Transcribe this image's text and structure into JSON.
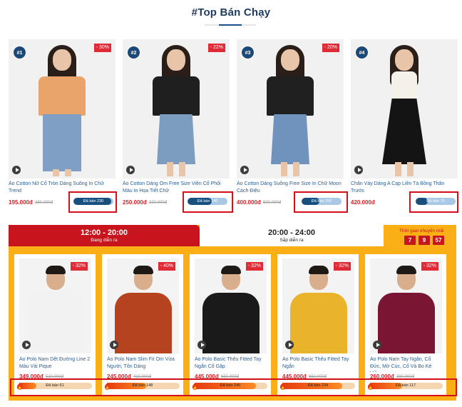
{
  "section_title": "#Top Bán Chạy",
  "top_products": [
    {
      "rank": "#1",
      "discount": "- 30%",
      "name": "Áo Cotton Nữ Cổ Tròn Dáng Suông In Chữ Trend",
      "price": "195.000đ",
      "old_price": "280.000đ",
      "sold": "Đã bán 230",
      "sold_fraction": 0.95,
      "top_color": "#e8a46a",
      "bottom_color": "#7f9fc5"
    },
    {
      "rank": "#2",
      "discount": "- 22%",
      "name": "Áo Cotton Dáng Ôm Free Size Viền Cổ Phối Màu In Họa Tiết Chữ",
      "price": "250.000đ",
      "old_price": "320.000đ",
      "sold": "Đã bán 140",
      "sold_fraction": 0.6,
      "top_color": "#1f1f1f",
      "bottom_color": "#7c9cc0"
    },
    {
      "rank": "#3",
      "discount": "- 20%",
      "name": "Áo Cotton Dáng Suông Free Size In Chữ Moon Cách Điệu",
      "price": "400.000đ",
      "old_price": "500.000đ",
      "sold": "Đã bán 100",
      "sold_fraction": 0.45,
      "top_color": "#202020",
      "bottom_color": "#6f93bd"
    },
    {
      "rank": "#4",
      "discount": "",
      "name": "Chân Váy Dáng A Cạp Liền Tà Bồng Thân Trước",
      "price": "420.000đ",
      "old_price": "",
      "sold": "Đã bán 70",
      "sold_fraction": 0.3,
      "top_color": "#f4f1ea",
      "bottom_color": "#141414"
    }
  ],
  "flash_sale": {
    "tabs": [
      {
        "time": "12:00 - 20:00",
        "status": "Đang diễn ra"
      },
      {
        "time": "20:00 - 24:00",
        "status": "Sắp diễn ra"
      }
    ],
    "countdown_label": "Thời gian khuyến mãi",
    "countdown": [
      "7",
      "9",
      "57"
    ],
    "products": [
      {
        "discount": "- 32%",
        "name": "Áo Polo Nam Dệt Đường Line 2 Màu Vải Pique",
        "price": "349.000đ",
        "old_price": "510.000đ",
        "sold": "Đã bán 61",
        "sold_fraction": 0.25,
        "shirt_color": "#f2f2f2"
      },
      {
        "discount": "- 40%",
        "name": "Áo Polo Nam Slim Fit Ôm Vừa Người, Tôn Dáng",
        "price": "245.000đ",
        "old_price": "410.000đ",
        "sold": "Đã bán 148",
        "sold_fraction": 0.55,
        "shirt_color": "#b5431f"
      },
      {
        "discount": "- 32%",
        "name": "Áo Polo Basic Thêu Fitted Tay Ngắn Cổ Gập",
        "price": "445.000đ",
        "old_price": "650.000đ",
        "sold": "Đã bán 240",
        "sold_fraction": 0.85,
        "shirt_color": "#1a1a1a"
      },
      {
        "discount": "- 32%",
        "name": "Áo Polo Basic Thêu Fitted Tay Ngắn",
        "price": "445.000đ",
        "old_price": "650.000đ",
        "sold": "Đã bán 234",
        "sold_fraction": 0.83,
        "shirt_color": "#e9b42c"
      },
      {
        "discount": "- 32%",
        "name": "Áo Polo Nam Tay Ngắn, Cổ Đức, Mờ Cúc, Cổ Và Bo Kẻ Viền",
        "price": "260.000đ",
        "old_price": "380.000đ",
        "sold": "Đã bán 117",
        "sold_fraction": 0.45,
        "shirt_color": "#7a1634"
      }
    ]
  },
  "colors": {
    "brand_blue": "#1c4a78",
    "sale_red": "#c8141c",
    "flash_yellow": "#fbaf16"
  }
}
